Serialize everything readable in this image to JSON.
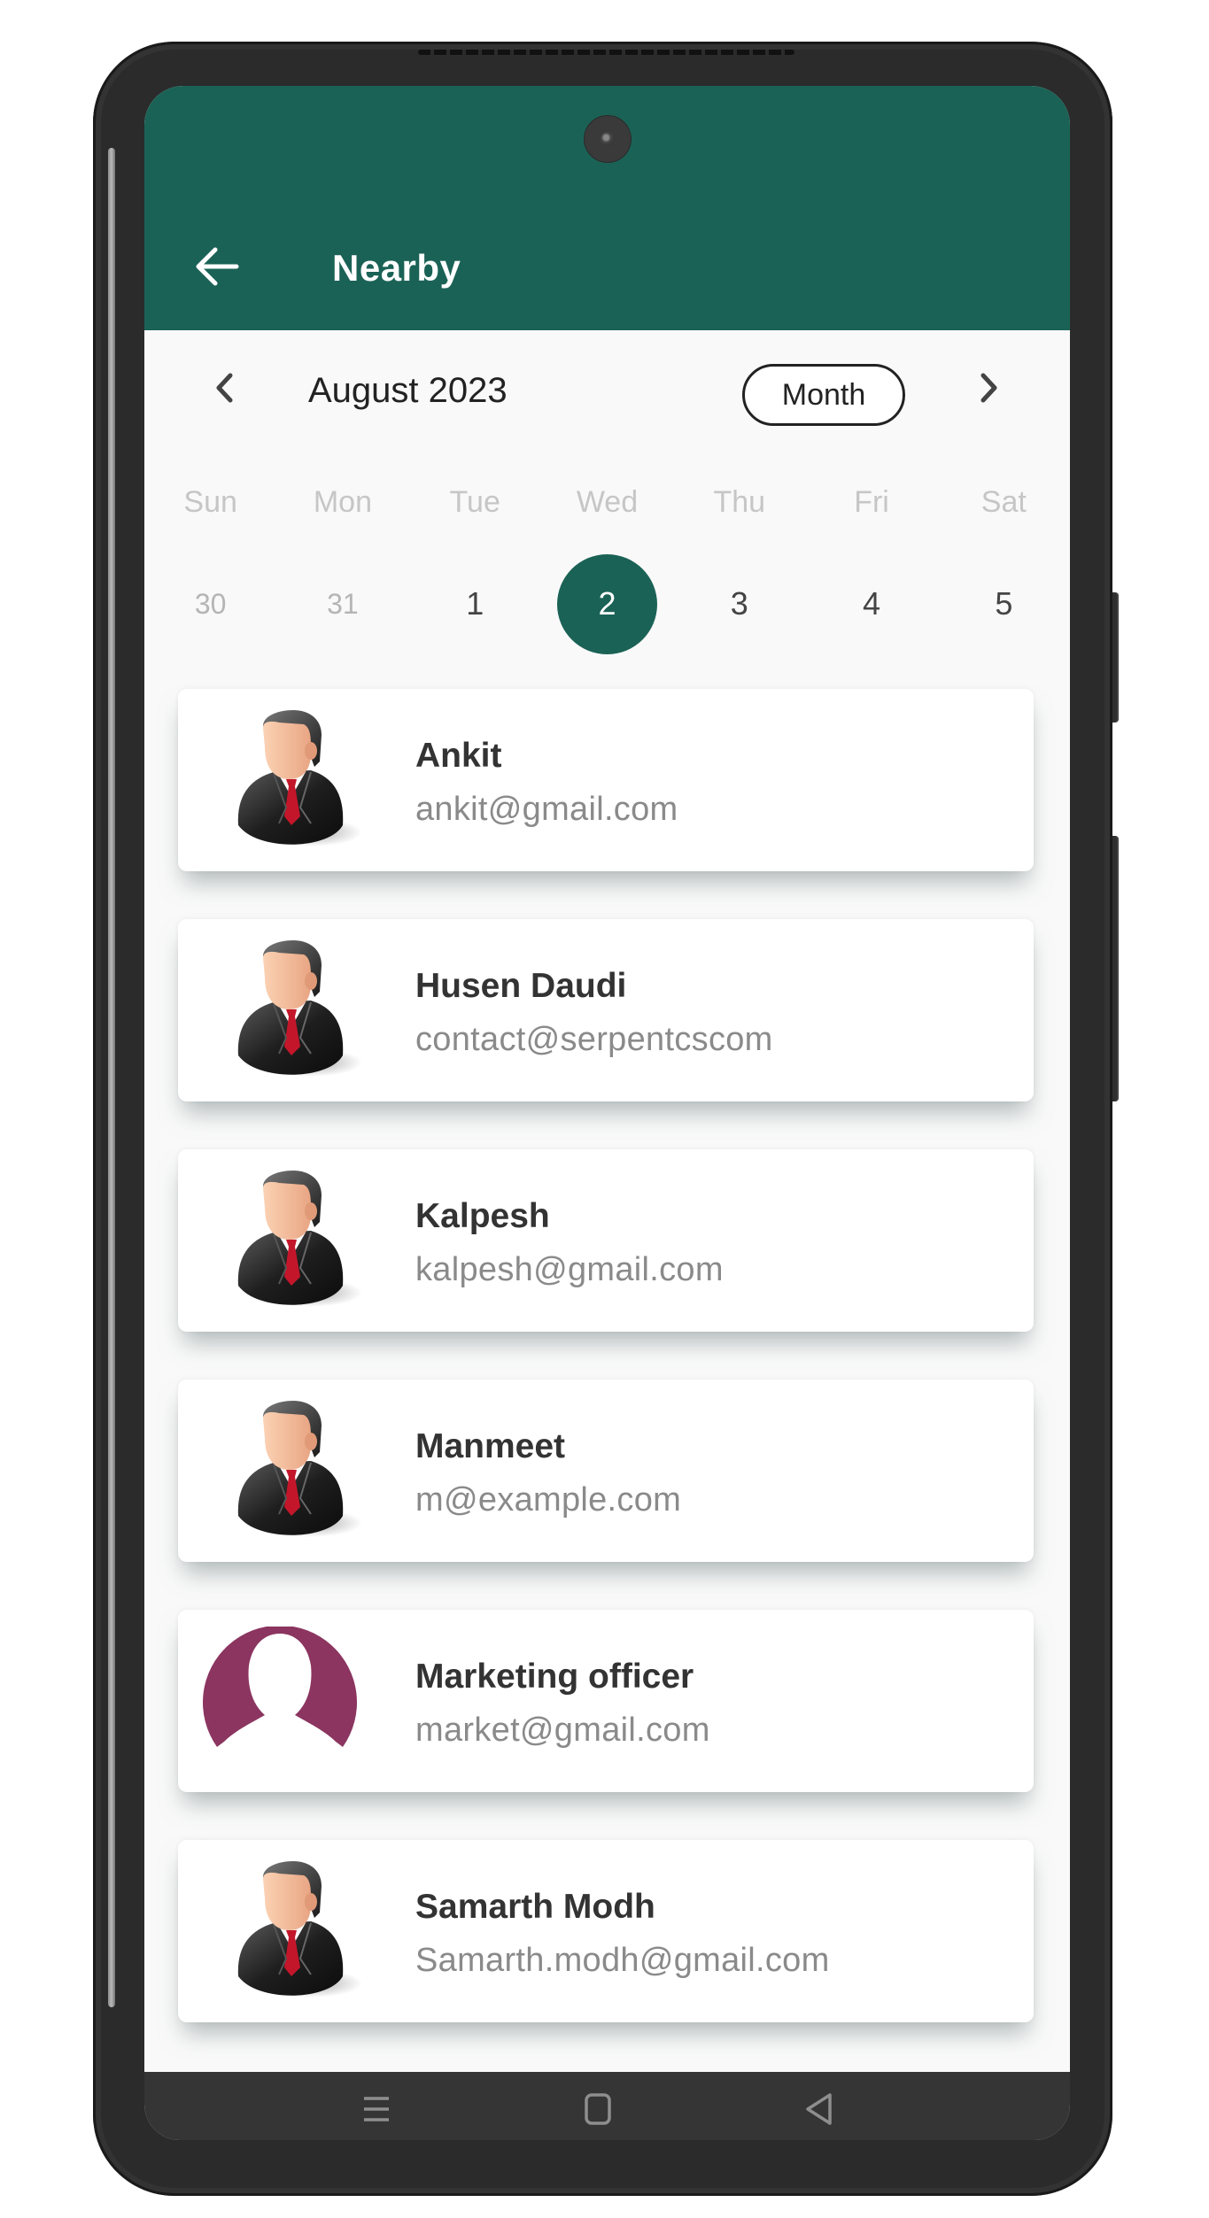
{
  "colors": {
    "primary": "#1b6256",
    "marketing_avatar": "#8b3560",
    "name_text": "#333333",
    "email_text": "#8a8a8a"
  },
  "header": {
    "back_icon": "arrow-left-icon",
    "title": "Nearby"
  },
  "calendar": {
    "prev_icon": "chevron-left-icon",
    "next_icon": "chevron-right-icon",
    "month_label": "August 2023",
    "view_toggle_label": "Month",
    "weekdays": [
      "Sun",
      "Mon",
      "Tue",
      "Wed",
      "Thu",
      "Fri",
      "Sat"
    ],
    "dates": [
      {
        "label": "30",
        "muted": true,
        "selected": false
      },
      {
        "label": "31",
        "muted": true,
        "selected": false
      },
      {
        "label": "1",
        "muted": false,
        "selected": false
      },
      {
        "label": "2",
        "muted": false,
        "selected": true
      },
      {
        "label": "3",
        "muted": false,
        "selected": false
      },
      {
        "label": "4",
        "muted": false,
        "selected": false
      },
      {
        "label": "5",
        "muted": false,
        "selected": false
      }
    ]
  },
  "contacts": [
    {
      "name": "Ankit",
      "email": "ankit@gmail.com",
      "avatar": "businessman-avatar-icon"
    },
    {
      "name": "Husen Daudi",
      "email": "contact@serpentcscom",
      "avatar": "businessman-avatar-icon"
    },
    {
      "name": "Kalpesh",
      "email": "kalpesh@gmail.com",
      "avatar": "businessman-avatar-icon"
    },
    {
      "name": "Manmeet",
      "email": "m@example.com",
      "avatar": "businessman-avatar-icon"
    },
    {
      "name": "Marketing officer",
      "email": "market@gmail.com",
      "avatar": "placeholder-person-icon"
    },
    {
      "name": "Samarth Modh",
      "email": "Samarth.modh@gmail.com",
      "avatar": "businessman-avatar-icon"
    }
  ],
  "system_nav": {
    "recents_icon": "menu-lines-icon",
    "home_icon": "square-home-icon",
    "back_icon": "triangle-back-icon"
  }
}
